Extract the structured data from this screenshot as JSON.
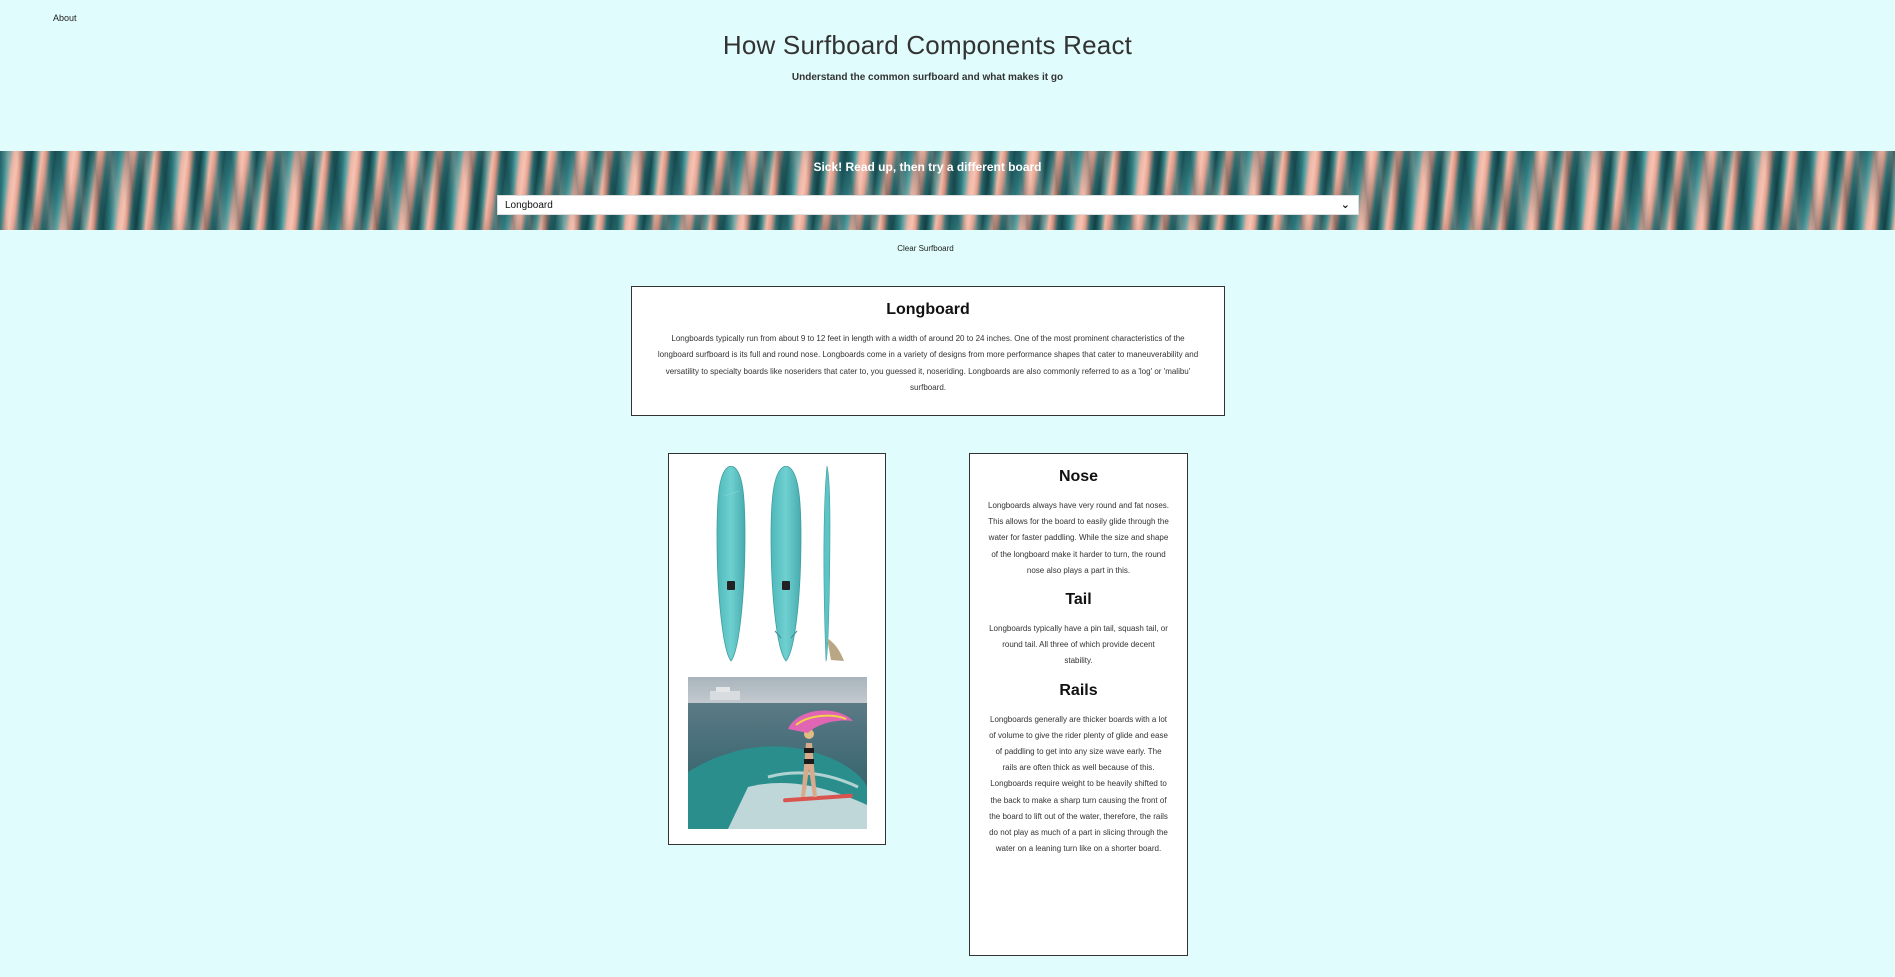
{
  "nav": {
    "about": "About"
  },
  "header": {
    "title": "How Surfboard Components React",
    "subtitle": "Understand the common surfboard and what makes it go"
  },
  "banner": {
    "heading": "Sick! Read up, then try a different board",
    "select_value": "Longboard"
  },
  "clear_button": "Clear Surfboard",
  "board": {
    "name": "Longboard",
    "description": "Longboards typically run from about 9 to 12 feet in length with a width of around 20 to 24 inches. One of the most prominent characteristics of the longboard surfboard is its full and round nose. Longboards come in a variety of designs from more performance shapes that cater to maneuverability and versatility to specialty boards like noseriders that cater to, you guessed it, noseriding. Longboards are also commonly referred to as a 'log' or 'malibu' surfboard."
  },
  "parts": [
    {
      "title": "Nose",
      "text": "Longboards always have very round and fat noses. This allows for the board to easily glide through the water for faster paddling. While the size and shape of the longboard make it harder to turn, the round nose also plays a part in this."
    },
    {
      "title": "Tail",
      "text": "Longboards typically have a pin tail, squash tail, or round tail. All three of which provide decent stability."
    },
    {
      "title": "Rails",
      "text": "Longboards generally are thicker boards with a lot of volume to give the rider plenty of glide and ease of paddling to get into any size wave early. The rails are often thick as well because of this. Longboards require weight to be heavily shifted to the back to make a sharp turn causing the front of the board to lift out of the water, therefore, the rails do not play as much of a part in slicing through the water on a leaning turn like on a shorter board."
    }
  ],
  "colors": {
    "page_background": "#e0fcfc",
    "board_color": "#5cc4c6",
    "card_border": "#333333"
  }
}
